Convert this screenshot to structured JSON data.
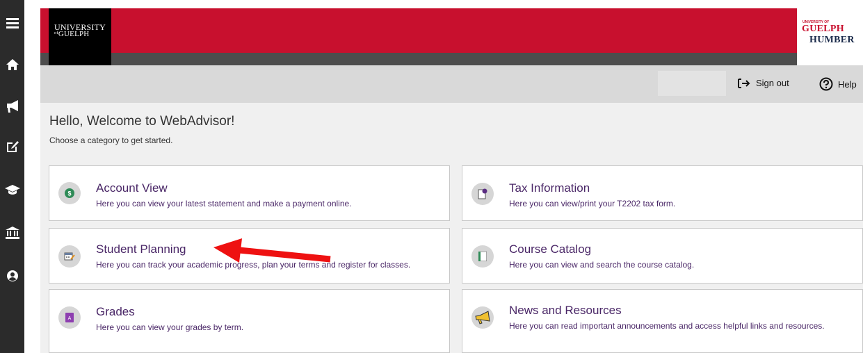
{
  "header": {
    "logo_line1": "UNIVERSITY",
    "logo_line2": "ᵒᶠGUELPH",
    "partner_small": "UNIVERSITY OF",
    "partner_guelph": "GUELPH",
    "partner_humber": "HUMBER"
  },
  "userbar": {
    "signout_label": "Sign out",
    "help_label": "Help"
  },
  "welcome": {
    "title": "Hello, Welcome to WebAdvisor!",
    "subtitle": "Choose a category to get started."
  },
  "cards": {
    "account": {
      "title": "Account View",
      "desc": "Here you can view your latest statement and make a payment online."
    },
    "tax": {
      "title": "Tax Information",
      "desc": "Here you can view/print your T2202 tax form."
    },
    "planning": {
      "title": "Student Planning",
      "desc": "Here you can track your academic progress, plan your terms and register for classes."
    },
    "catalog": {
      "title": "Course Catalog",
      "desc": "Here you can view and search the course catalog."
    },
    "grades": {
      "title": "Grades",
      "desc": "Here you can view your grades by term."
    },
    "news": {
      "title": "News and Resources",
      "desc": "Here you can read important announcements and access helpful links and resources."
    }
  },
  "colors": {
    "brand_red": "#c8102e",
    "nav_dark": "#2b2b2b",
    "link_purple": "#4a2767",
    "annotation_arrow": "#ee1111"
  },
  "icons": {
    "nav": [
      "menu-icon",
      "home-icon",
      "megaphone-icon",
      "edit-icon",
      "graduation-cap-icon",
      "bank-icon",
      "user-circle-icon"
    ],
    "cards": [
      "dollar-icon",
      "tax-form-icon",
      "calendar-icon",
      "book-icon",
      "grade-icon",
      "megaphone-icon"
    ]
  }
}
